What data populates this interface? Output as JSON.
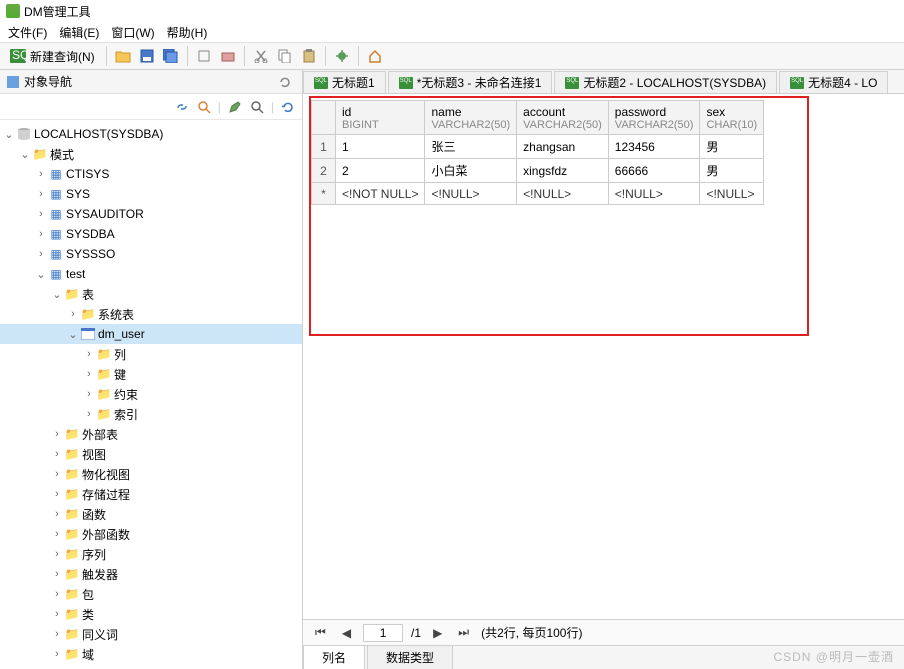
{
  "title": "DM管理工具",
  "menu": {
    "file": "文件(F)",
    "edit": "编辑(E)",
    "window": "窗口(W)",
    "help": "帮助(H)"
  },
  "toolbar": {
    "new_query": "新建查询(N)"
  },
  "side_panel": {
    "title": "对象导航"
  },
  "tree": {
    "root": "LOCALHOST(SYSDBA)",
    "schema_root": "模式",
    "schemas": [
      "CTISYS",
      "SYS",
      "SYSAUDITOR",
      "SYSDBA",
      "SYSSSO"
    ],
    "test_schema": "test",
    "tables_folder": "表",
    "sys_tables": "系统表",
    "selected_table": "dm_user",
    "table_children": [
      "列",
      "键",
      "约束",
      "索引"
    ],
    "other_folders": [
      "外部表",
      "视图",
      "物化视图",
      "存储过程",
      "函数",
      "外部函数",
      "序列",
      "触发器",
      "包",
      "类",
      "同义词",
      "域"
    ]
  },
  "tabs": [
    {
      "label": "无标题1"
    },
    {
      "label": "*无标题3 - 未命名连接1"
    },
    {
      "label": "无标题2 - LOCALHOST(SYSDBA)"
    },
    {
      "label": "无标题4 - LO"
    }
  ],
  "grid": {
    "columns": [
      {
        "name": "id",
        "type": "BIGINT"
      },
      {
        "name": "name",
        "type": "VARCHAR2(50)"
      },
      {
        "name": "account",
        "type": "VARCHAR2(50)"
      },
      {
        "name": "password",
        "type": "VARCHAR2(50)"
      },
      {
        "name": "sex",
        "type": "CHAR(10)"
      }
    ],
    "rows": [
      {
        "num": "1",
        "cells": [
          "1",
          "张三",
          "zhangsan",
          "123456",
          "男"
        ]
      },
      {
        "num": "2",
        "cells": [
          "2",
          "小白菜",
          "xingsfdz",
          "66666",
          "男"
        ]
      }
    ],
    "newrow": {
      "num": "*",
      "cells": [
        "<!NOT NULL>",
        "<!NULL>",
        "<!NULL>",
        "<!NULL>",
        "<!NULL>"
      ]
    }
  },
  "pager": {
    "page": "1",
    "total_pages": "/1",
    "summary": "(共2行, 每页100行)"
  },
  "bottom_tabs": {
    "t1": "列名",
    "t2": "数据类型"
  },
  "watermark": "CSDN @明月一壶酒"
}
